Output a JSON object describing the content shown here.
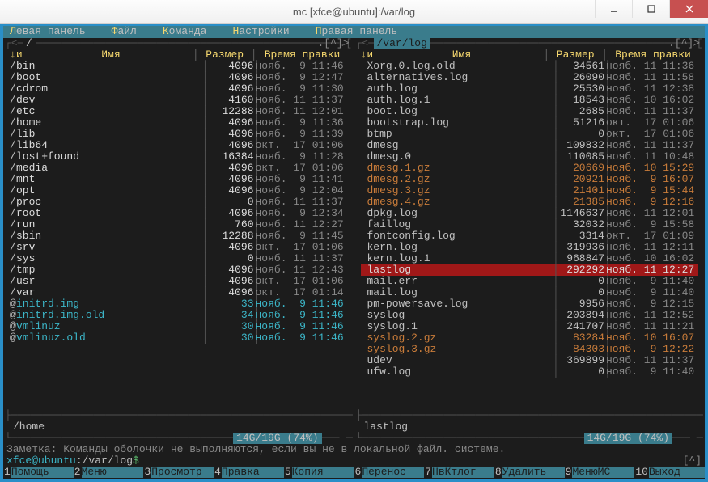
{
  "window": {
    "title": "mc [xfce@ubuntu]:/var/log"
  },
  "menu": [
    {
      "hotkey": "Л",
      "label": "евая панель"
    },
    {
      "hotkey": "Ф",
      "label": "айл"
    },
    {
      "hotkey": "К",
      "label": "оманда"
    },
    {
      "hotkey": "Н",
      "label": "астройки"
    },
    {
      "hotkey": "П",
      "label": "равая панель"
    }
  ],
  "left_panel": {
    "path": "/",
    "headers": {
      "n": "и",
      "arrow": "↓",
      "name": "Имя",
      "size": "Размер",
      "date": "Время правки"
    },
    "rows": [
      {
        "t": "dir",
        "m": "/",
        "name": "bin",
        "size": "4096",
        "date": "нояб.  9 11:46"
      },
      {
        "t": "dir",
        "m": "/",
        "name": "boot",
        "size": "4096",
        "date": "нояб.  9 12:47"
      },
      {
        "t": "dir",
        "m": "/",
        "name": "cdrom",
        "size": "4096",
        "date": "нояб.  9 11:30"
      },
      {
        "t": "dir",
        "m": "/",
        "name": "dev",
        "size": "4160",
        "date": "нояб. 11 11:37"
      },
      {
        "t": "dir",
        "m": "/",
        "name": "etc",
        "size": "12288",
        "date": "нояб. 11 12:01"
      },
      {
        "t": "dir",
        "m": "/",
        "name": "home",
        "size": "4096",
        "date": "нояб.  9 11:36"
      },
      {
        "t": "dir",
        "m": "/",
        "name": "lib",
        "size": "4096",
        "date": "нояб.  9 11:39"
      },
      {
        "t": "dir",
        "m": "/",
        "name": "lib64",
        "size": "4096",
        "date": "окт.  17 01:06"
      },
      {
        "t": "dir",
        "m": "/",
        "name": "lost+found",
        "size": "16384",
        "date": "нояб.  9 11:28"
      },
      {
        "t": "dir",
        "m": "/",
        "name": "media",
        "size": "4096",
        "date": "окт.  17 01:06"
      },
      {
        "t": "dir",
        "m": "/",
        "name": "mnt",
        "size": "4096",
        "date": "нояб.  9 11:41"
      },
      {
        "t": "dir",
        "m": "/",
        "name": "opt",
        "size": "4096",
        "date": "нояб.  9 12:04"
      },
      {
        "t": "dir",
        "m": "/",
        "name": "proc",
        "size": "0",
        "date": "нояб. 11 11:37"
      },
      {
        "t": "dir",
        "m": "/",
        "name": "root",
        "size": "4096",
        "date": "нояб.  9 12:34"
      },
      {
        "t": "dir",
        "m": "/",
        "name": "run",
        "size": "760",
        "date": "нояб. 11 12:27"
      },
      {
        "t": "dir",
        "m": "/",
        "name": "sbin",
        "size": "12288",
        "date": "нояб.  9 11:45"
      },
      {
        "t": "dir",
        "m": "/",
        "name": "srv",
        "size": "4096",
        "date": "окт.  17 01:06"
      },
      {
        "t": "dir",
        "m": "/",
        "name": "sys",
        "size": "0",
        "date": "нояб. 11 11:37"
      },
      {
        "t": "dir",
        "m": "/",
        "name": "tmp",
        "size": "4096",
        "date": "нояб. 11 12:43"
      },
      {
        "t": "dir",
        "m": "/",
        "name": "usr",
        "size": "4096",
        "date": "окт.  17 01:06"
      },
      {
        "t": "dir",
        "m": "/",
        "name": "var",
        "size": "4096",
        "date": "окт.  17 01:14"
      },
      {
        "t": "link",
        "m": "@",
        "name": "initrd.img",
        "size": "33",
        "date": "нояб.  9 11:46"
      },
      {
        "t": "link",
        "m": "@",
        "name": "initrd.img.old",
        "size": "34",
        "date": "нояб.  9 11:46"
      },
      {
        "t": "link",
        "m": "@",
        "name": "vmlinuz",
        "size": "30",
        "date": "нояб.  9 11:46"
      },
      {
        "t": "link",
        "m": "@",
        "name": "vmlinuz.old",
        "size": "30",
        "date": "нояб.  9 11:46"
      }
    ],
    "footer": "/home",
    "stats": "14G/19G (74%)"
  },
  "right_panel": {
    "path": "/var/log",
    "headers": {
      "n": "и",
      "arrow": "↓",
      "name": "Имя",
      "size": "Размер",
      "date": "Время правки"
    },
    "rows": [
      {
        "t": "file",
        "m": " ",
        "name": "Xorg.0.log.old",
        "size": "34561",
        "date": "нояб. 11 11:36"
      },
      {
        "t": "file",
        "m": " ",
        "name": "alternatives.log",
        "size": "26090",
        "date": "нояб. 11 11:58"
      },
      {
        "t": "file",
        "m": " ",
        "name": "auth.log",
        "size": "25530",
        "date": "нояб. 11 12:38"
      },
      {
        "t": "file",
        "m": " ",
        "name": "auth.log.1",
        "size": "18543",
        "date": "нояб. 10 16:02"
      },
      {
        "t": "file",
        "m": " ",
        "name": "boot.log",
        "size": "2685",
        "date": "нояб. 11 11:37"
      },
      {
        "t": "file",
        "m": " ",
        "name": "bootstrap.log",
        "size": "51216",
        "date": "окт.  17 01:06"
      },
      {
        "t": "file",
        "m": " ",
        "name": "btmp",
        "size": "0",
        "date": "окт.  17 01:06"
      },
      {
        "t": "file",
        "m": " ",
        "name": "dmesg",
        "size": "109832",
        "date": "нояб. 11 11:37"
      },
      {
        "t": "file",
        "m": " ",
        "name": "dmesg.0",
        "size": "110085",
        "date": "нояб. 11 10:48"
      },
      {
        "t": "archive",
        "m": " ",
        "name": "dmesg.1.gz",
        "size": "20669",
        "date": "нояб. 10 15:29"
      },
      {
        "t": "archive",
        "m": " ",
        "name": "dmesg.2.gz",
        "size": "20921",
        "date": "нояб.  9 16:07"
      },
      {
        "t": "archive",
        "m": " ",
        "name": "dmesg.3.gz",
        "size": "21401",
        "date": "нояб.  9 15:44"
      },
      {
        "t": "archive",
        "m": " ",
        "name": "dmesg.4.gz",
        "size": "21385",
        "date": "нояб.  9 12:16"
      },
      {
        "t": "file",
        "m": " ",
        "name": "dpkg.log",
        "size": "1146637",
        "date": "нояб. 11 12:01"
      },
      {
        "t": "file",
        "m": " ",
        "name": "faillog",
        "size": "32032",
        "date": "нояб.  9 15:58"
      },
      {
        "t": "file",
        "m": " ",
        "name": "fontconfig.log",
        "size": "3314",
        "date": "окт.  17 01:09"
      },
      {
        "t": "file",
        "m": " ",
        "name": "kern.log",
        "size": "319936",
        "date": "нояб. 11 12:11"
      },
      {
        "t": "file",
        "m": " ",
        "name": "kern.log.1",
        "size": "968847",
        "date": "нояб. 10 16:02"
      },
      {
        "t": "selected",
        "m": " ",
        "name": "lastlog",
        "size": "292292",
        "date": "нояб. 11 12:27"
      },
      {
        "t": "file",
        "m": " ",
        "name": "mail.err",
        "size": "0",
        "date": "нояб.  9 11:40"
      },
      {
        "t": "file",
        "m": " ",
        "name": "mail.log",
        "size": "0",
        "date": "нояб.  9 11:40"
      },
      {
        "t": "file",
        "m": " ",
        "name": "pm-powersave.log",
        "size": "9956",
        "date": "нояб.  9 12:15"
      },
      {
        "t": "file",
        "m": " ",
        "name": "syslog",
        "size": "203894",
        "date": "нояб. 11 12:52"
      },
      {
        "t": "file",
        "m": " ",
        "name": "syslog.1",
        "size": "241707",
        "date": "нояб. 11 11:21"
      },
      {
        "t": "archive",
        "m": " ",
        "name": "syslog.2.gz",
        "size": "83284",
        "date": "нояб. 10 16:07"
      },
      {
        "t": "archive",
        "m": " ",
        "name": "syslog.3.gz",
        "size": "84303",
        "date": "нояб.  9 12:22"
      },
      {
        "t": "file",
        "m": " ",
        "name": "udev",
        "size": "369899",
        "date": "нояб. 11 11:37"
      },
      {
        "t": "file",
        "m": " ",
        "name": "ufw.log",
        "size": "0",
        "date": "нояб.  9 11:40"
      }
    ],
    "footer": "lastlog",
    "stats": "14G/19G (74%)"
  },
  "hint": "Заметка: Команды оболочки не выполняются, если вы не в локальной файл. системе.",
  "prompt": {
    "user": "xfce@ubuntu",
    "path": ":/var/log",
    "sym": "$",
    "ind": "[^]"
  },
  "fkeys": [
    {
      "n": "1",
      "l": "Помощь"
    },
    {
      "n": "2",
      "l": "Меню"
    },
    {
      "n": "3",
      "l": "Просмотр"
    },
    {
      "n": "4",
      "l": "Правка"
    },
    {
      "n": "5",
      "l": "Копия"
    },
    {
      "n": "6",
      "l": "Перенос"
    },
    {
      "n": "7",
      "l": "НвКтлог"
    },
    {
      "n": "8",
      "l": "Удалить"
    },
    {
      "n": "9",
      "l": "МенюМС"
    },
    {
      "n": "10",
      "l": "Выход"
    }
  ]
}
